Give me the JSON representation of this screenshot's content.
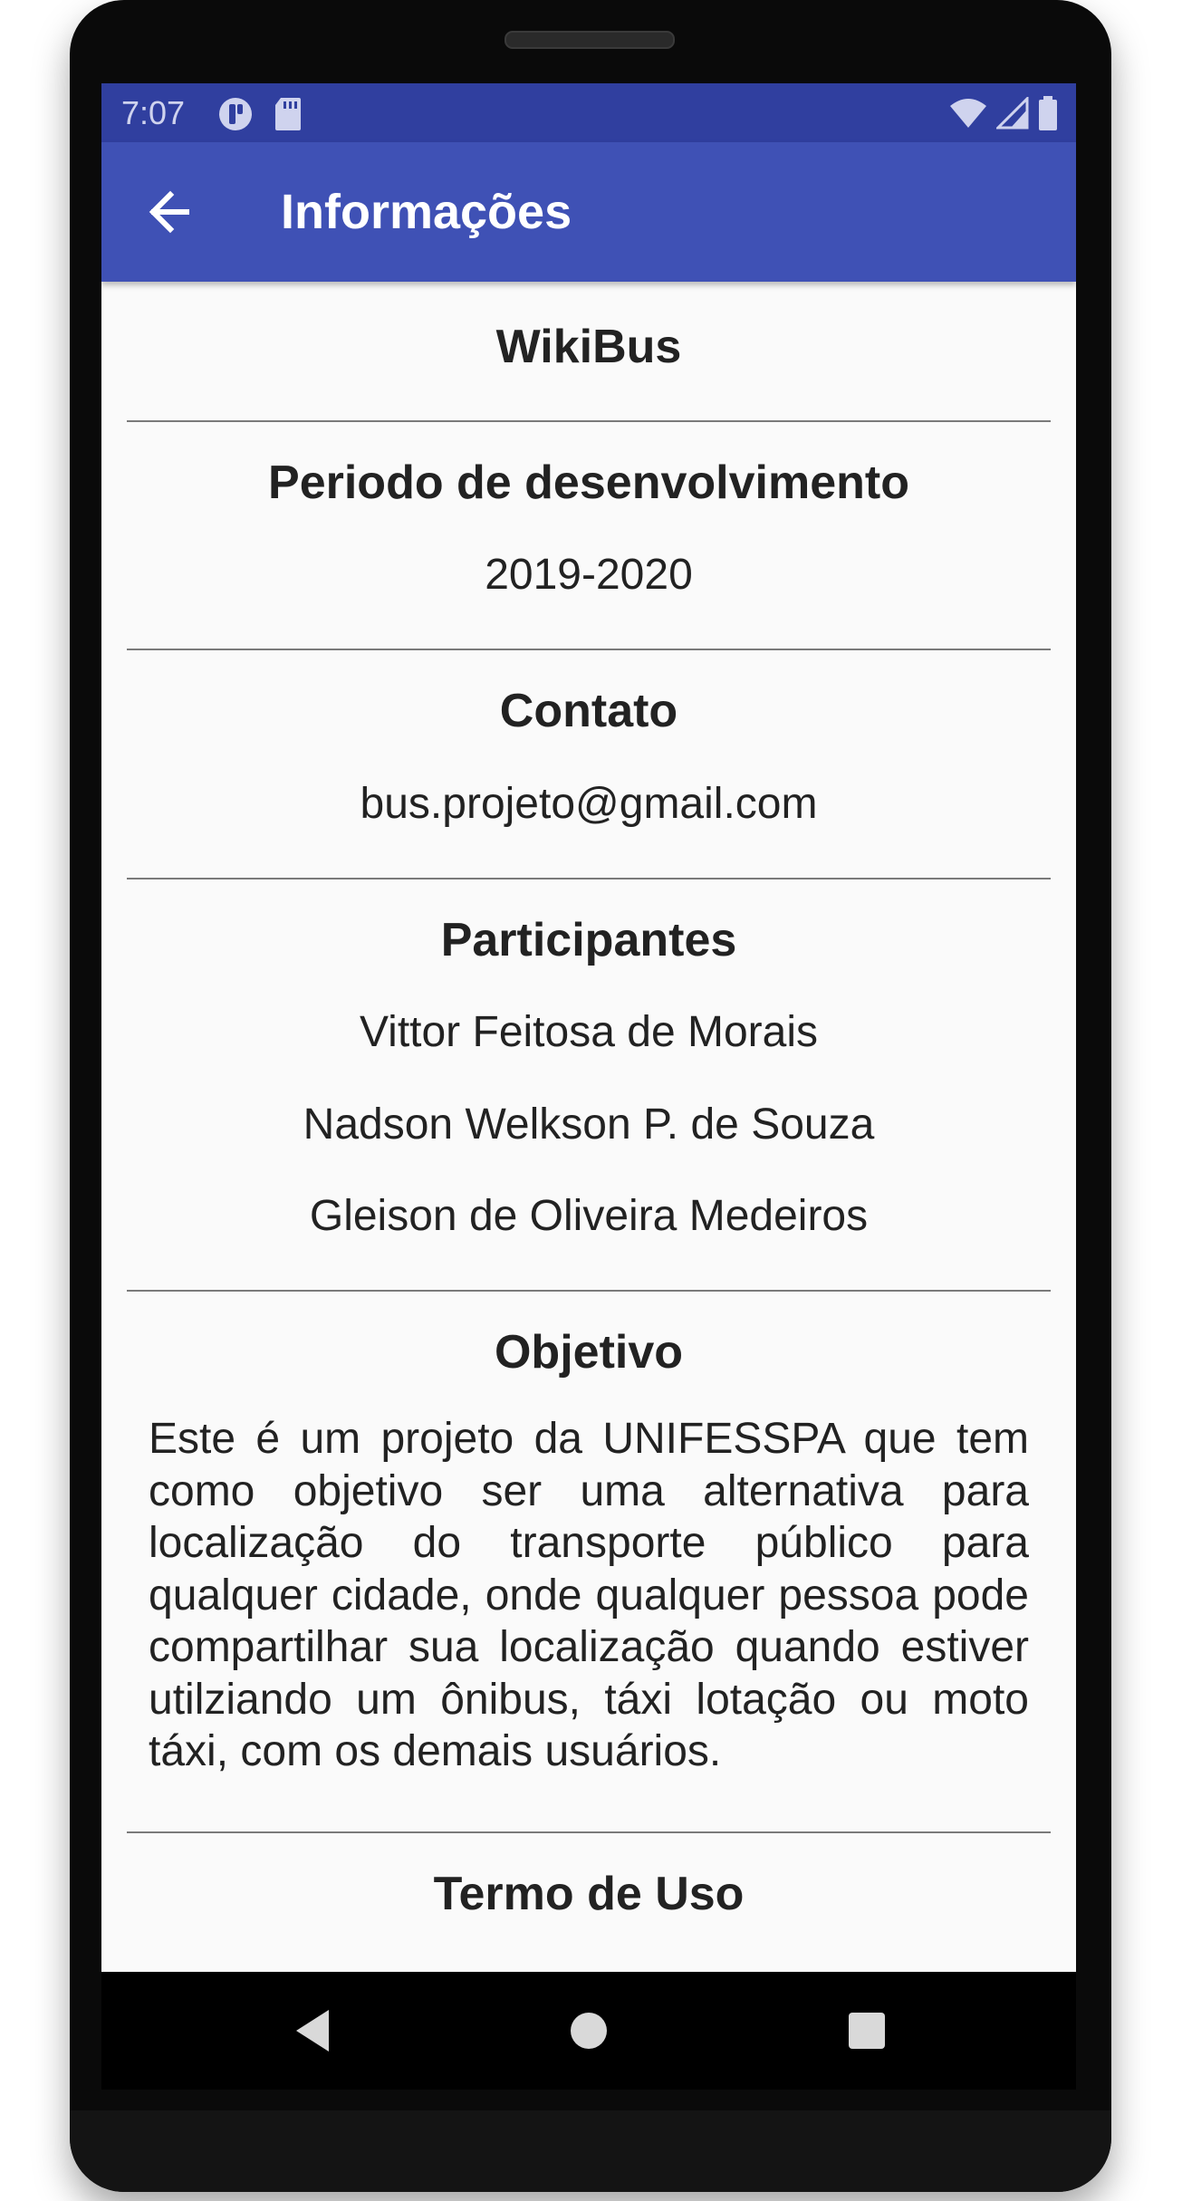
{
  "status_bar": {
    "time": "7:07",
    "icons_left": [
      "notification-app-icon",
      "sd-card-icon"
    ],
    "icons_right": [
      "wifi-icon",
      "signal-icon",
      "battery-icon"
    ]
  },
  "app_bar": {
    "title": "Informações",
    "back_icon": "arrow-back-icon",
    "color": "#3f51b5"
  },
  "sections": {
    "app_name": "WikiBus",
    "period": {
      "title": "Periodo de desenvolvimento",
      "value": "2019-2020"
    },
    "contact": {
      "title": "Contato",
      "value": "bus.projeto@gmail.com"
    },
    "participants": {
      "title": "Participantes",
      "names": [
        "Vittor Feitosa de Morais",
        "Nadson Welkson P. de Souza",
        "Gleison de Oliveira Medeiros"
      ]
    },
    "objective": {
      "title": "Objetivo",
      "text": "Este é um projeto da UNIFESSPA que tem como objetivo ser uma alternativa para localização do transporte público para qualquer cidade, onde qualquer pessoa pode compartilhar sua localização quando estiver utilziando um ônibus, táxi lotação ou moto táxi, com os demais usuários."
    },
    "terms": {
      "title": "Termo de Uso"
    }
  },
  "nav_bar": {
    "buttons": [
      "back-triangle-icon",
      "home-circle-icon",
      "recents-square-icon"
    ]
  },
  "colors": {
    "status_bar": "#303f9f",
    "app_bar": "#3f51b5",
    "background": "#fafafa",
    "text": "#222222"
  }
}
